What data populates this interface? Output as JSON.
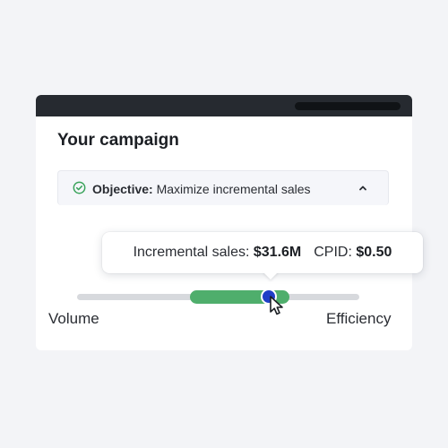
{
  "card": {
    "title": "Your campaign"
  },
  "objective": {
    "label": "Objective:",
    "value": "Maximize incremental sales",
    "status_icon": "check-circle-icon",
    "toggle_icon": "chevron-up-icon"
  },
  "tooltip": {
    "metric1_label": "Incremental sales:",
    "metric1_value": "$31.6M",
    "metric2_label": "CPID:",
    "metric2_value": "$0.50"
  },
  "slider": {
    "min_label": "Volume",
    "max_label": "Efficiency",
    "range_start": 0.4,
    "range_end": 0.75,
    "value": 0.69
  },
  "colors": {
    "background": "#f3f4f7",
    "titlebar": "#262a30",
    "range": "#4fae6c",
    "thumb": "#1f3fc7",
    "check": "#3aa35b"
  }
}
